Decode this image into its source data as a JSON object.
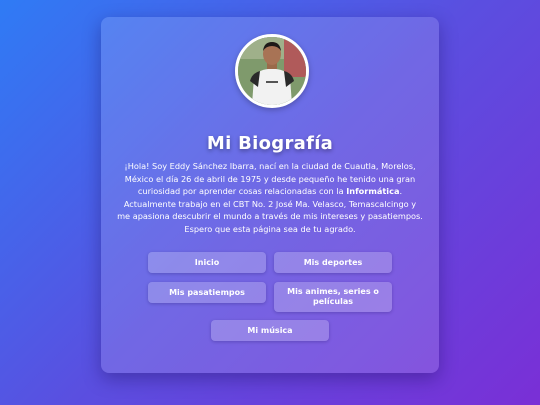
{
  "profile": {
    "title": "Mi Biografía",
    "bio_part1": "¡Hola! Soy Eddy Sánchez Ibarra, nací en la ciudad de Cuautla, Morelos, México el día 26 de abril de 1975 y desde pequeño he tenido una gran curiosidad por aprender cosas relacionadas con la ",
    "bio_bold": "Informática",
    "bio_part2": ". Actualmente trabajo en el CBT No. 2 José Ma. Velasco, Temascalcingo y me apasiona descubrir el mundo a través de mis intereses y pasatiempos. Espero que esta página sea de tu agrado."
  },
  "nav": {
    "inicio": "Inicio",
    "deportes": "Mis deportes",
    "pasatiempos": "Mis pasatiempos",
    "animes": "Mis animes, series o películas",
    "musica": "Mi música"
  },
  "colors": {
    "bg_start": "#2f7bf5",
    "bg_end": "#7a2fd6",
    "text": "#ffffff"
  }
}
